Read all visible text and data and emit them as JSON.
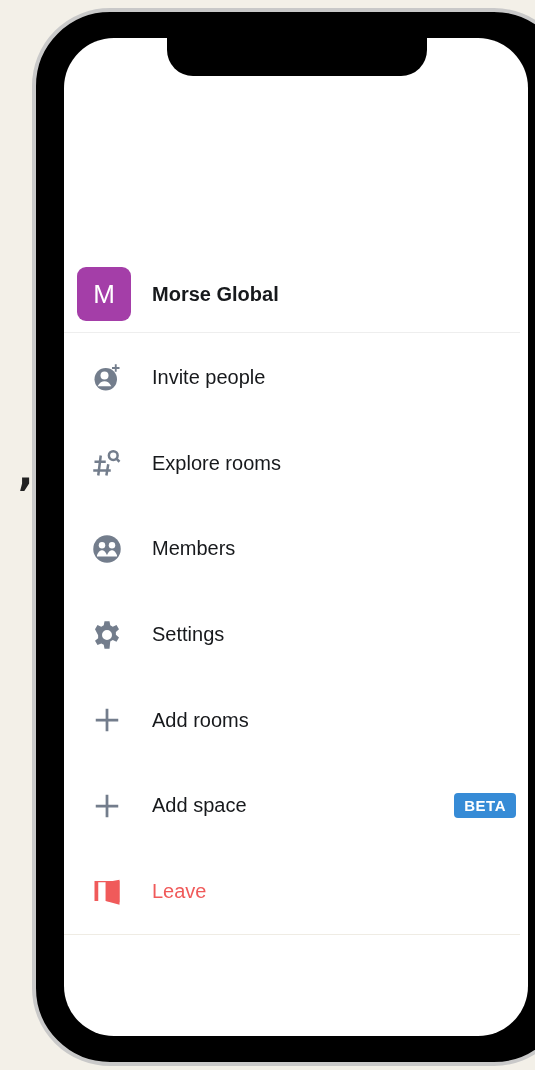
{
  "background_fragment": ",",
  "space": {
    "avatar_letter": "M",
    "name": "Morse Global"
  },
  "menu": [
    {
      "kind": "invite",
      "label": "Invite people"
    },
    {
      "kind": "explore",
      "label": "Explore rooms"
    },
    {
      "kind": "members",
      "label": "Members"
    },
    {
      "kind": "settings",
      "label": "Settings"
    },
    {
      "kind": "add",
      "label": "Add rooms"
    },
    {
      "kind": "add",
      "label": "Add space",
      "badge": "BETA"
    },
    {
      "kind": "leave",
      "label": "Leave"
    }
  ]
}
